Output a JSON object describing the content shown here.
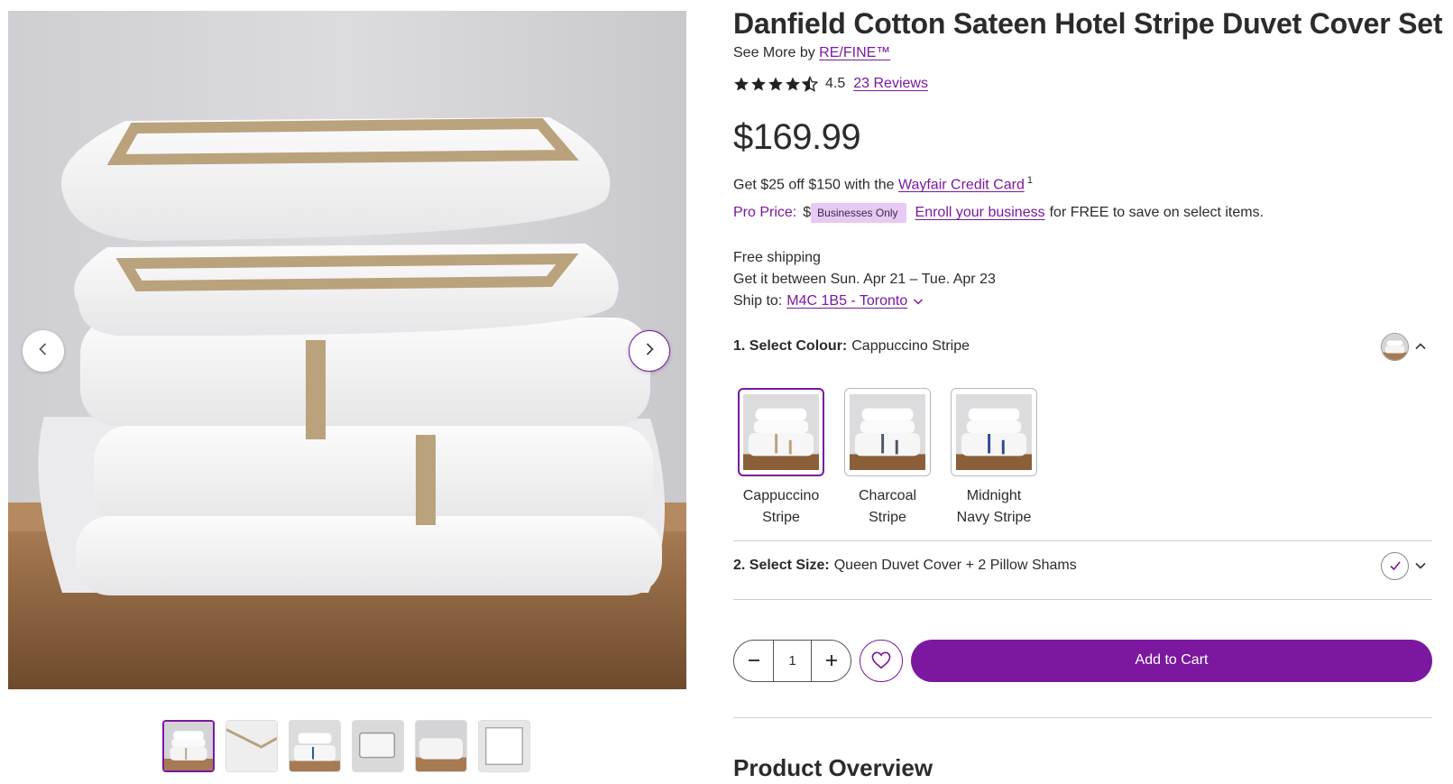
{
  "product": {
    "title": "Danfield Cotton Sateen Hotel Stripe Duvet Cover Set",
    "see_more_prefix": "See More by",
    "brand": "RE/FINE™",
    "rating": "4.5",
    "stars_value": 4.5,
    "reviews_link": "23 Reviews",
    "price": "$169.99"
  },
  "promo": {
    "credit_prefix": "Get $25 off $150 with the",
    "credit_link": "Wayfair Credit Card",
    "credit_footnote": "1",
    "pro_label": "Pro Price:",
    "pro_value": "$",
    "pro_badge": "Businesses Only",
    "enroll_link": "Enroll your business",
    "enroll_suffix": "for FREE to save on select items."
  },
  "shipping": {
    "free": "Free shipping",
    "dates": "Get it between Sun. Apr 21 – Tue. Apr 23",
    "ship_to_label": "Ship to:",
    "location": "M4C 1B5 - Toronto"
  },
  "colour_option": {
    "label": "1. Select Colour:",
    "value": "Cappuccino Stripe",
    "swatches": [
      {
        "line1": "Cappuccino",
        "line2": "Stripe",
        "color": "#b9a27c"
      },
      {
        "line1": "Charcoal",
        "line2": "Stripe",
        "color": "#4d5566"
      },
      {
        "line1": "Midnight",
        "line2": "Navy Stripe",
        "color": "#2b4c8c"
      }
    ]
  },
  "size_option": {
    "label": "2. Select Size:",
    "value": "Queen Duvet Cover + 2 Pillow Shams"
  },
  "cart": {
    "quantity": "1",
    "add_to_cart": "Add to Cart"
  },
  "section": {
    "overview_heading": "Product Overview"
  },
  "colors": {
    "accent": "#7b189f",
    "text": "#2b2b2b",
    "badge_bg": "#e7c9f4"
  },
  "icons": {
    "prev": "chevron-left-icon",
    "next": "chevron-right-icon",
    "star": "star-icon",
    "favorite": "heart-icon",
    "minus": "minus-icon",
    "plus": "plus-icon",
    "checkmark": "check-icon",
    "collapse": "chevron-up-icon",
    "expand": "chevron-down-icon"
  }
}
